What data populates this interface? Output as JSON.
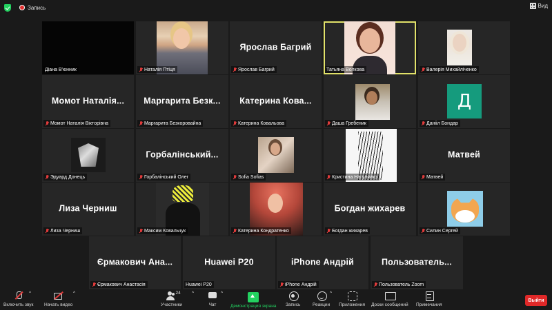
{
  "topbar": {
    "recording_label": "Запись",
    "view_label": "Вид"
  },
  "colors": {
    "background": "#1a1a1a",
    "tile": "#262626",
    "active_border": "#e2e26a",
    "muted_red": "#e03b3b",
    "share_green": "#23d160",
    "leave_red": "#e02828"
  },
  "tiles": {
    "diana": {
      "label": "Діана В'юнник"
    },
    "natalia": {
      "label": "Наталія Птіця"
    },
    "yaroslav": {
      "big": "Ярослав Багрий",
      "label": "Ярослав Багрий"
    },
    "tatyana": {
      "label": "Татьяна Волкова"
    },
    "valeria": {
      "label": "Валерія Михайліченко"
    },
    "momot": {
      "big": "Момот Наталія...",
      "label": "Момот Наталія Вікторівна"
    },
    "margarita": {
      "big": "Маргарита Безк...",
      "label": "Маргарита Безкоровайна"
    },
    "katerinaKov": {
      "big": "Катерина Кова...",
      "label": "Катерина Ковальова"
    },
    "dasha": {
      "label": "Даша Гребеник"
    },
    "daniia": {
      "label": "Данііл Бондар",
      "avatar_letter": "Д"
    },
    "eduard": {
      "label": "Эдуард Донець"
    },
    "gorb": {
      "big": "Горбалінський...",
      "label": "Горбалінський Олег"
    },
    "sofia": {
      "label": "Sofia Sofias"
    },
    "kristina": {
      "label": "Кристина Нагуляйко"
    },
    "matvey": {
      "big": "Матвей",
      "label": "Матвей"
    },
    "liza": {
      "big": "Лиза Черниш",
      "label": "Лиза Черниш"
    },
    "maksim": {
      "label": "Максим Ковальчук"
    },
    "katerinaKon": {
      "label": "Катерина Кондратенко"
    },
    "bogdan": {
      "big": "Богдан жихарев",
      "label": "Богдан жихарев"
    },
    "silin": {
      "label": "Силин Сергей"
    },
    "ermak": {
      "big": "Єрмакович Ана...",
      "label": "Єрмакович Анастасія"
    },
    "huawei": {
      "big": "Huawei P20",
      "label": "Huawei P20"
    },
    "iphone": {
      "big": "iPhone Андрій",
      "label": "iPhone Андрій"
    },
    "zoomuser": {
      "big": "Пользователь...",
      "label": "Пользователь Zoom"
    }
  },
  "toolbar": {
    "audio": "Включить звук",
    "video": "Начать видео",
    "participants": "Участники",
    "participants_count": "24",
    "chat": "Чат",
    "share": "Демонстрация экрана",
    "record": "Запись",
    "reactions": "Реакции",
    "apps": "Приложения",
    "whiteboard": "Доски сообщений",
    "notes": "Примечания",
    "leave": "Выйти"
  }
}
